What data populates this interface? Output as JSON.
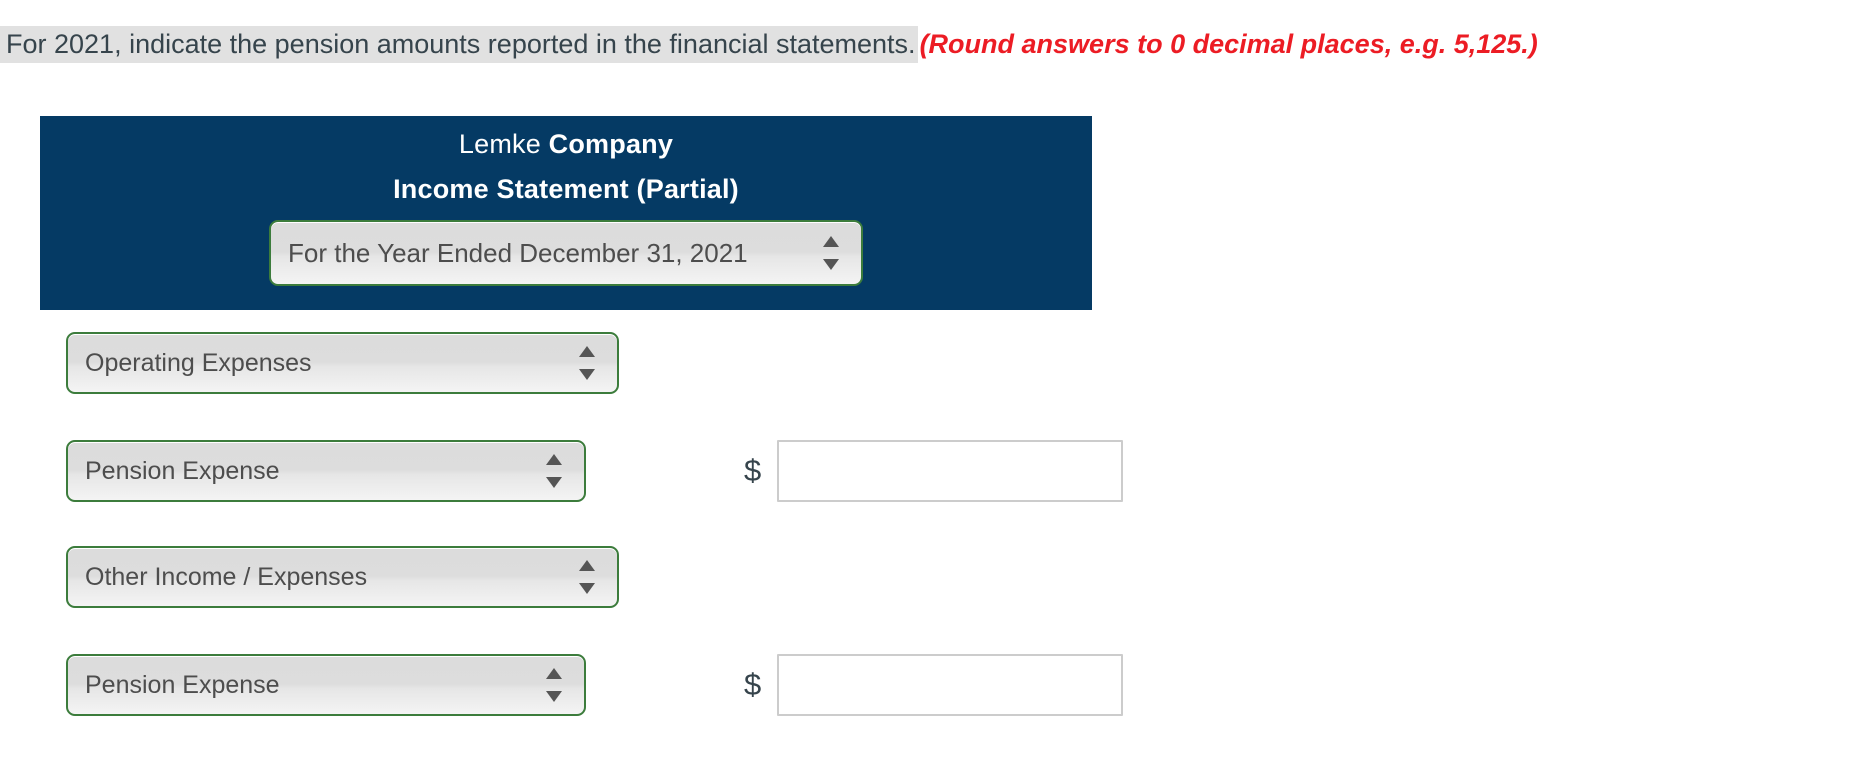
{
  "prompt": {
    "text": "For 2021, indicate the pension amounts reported in the financial statements.",
    "note": "(Round answers to 0 decimal places, e.g. 5,125.)",
    "highlight_color": "#e1e1e1",
    "note_color": "#ec1c24"
  },
  "statement": {
    "company_prefix": "Lemke ",
    "company_name": "Company",
    "title": "Income Statement (Partial)",
    "header_color": "#053a64",
    "period_select": {
      "value": "For the Year Ended December 31, 2021",
      "icon": "spinner-arrows-icon"
    }
  },
  "rows": [
    {
      "select": {
        "value": "Operating Expenses",
        "icon": "spinner-arrows-icon"
      },
      "has_amount": false,
      "currency": "",
      "amount_value": "",
      "amount_placeholder": ""
    },
    {
      "select": {
        "value": "Pension Expense",
        "icon": "spinner-arrows-icon"
      },
      "has_amount": true,
      "currency": "$",
      "amount_value": "",
      "amount_placeholder": ""
    },
    {
      "select": {
        "value": "Other Income / Expenses",
        "icon": "spinner-arrows-icon"
      },
      "has_amount": false,
      "currency": "",
      "amount_value": "",
      "amount_placeholder": ""
    },
    {
      "select": {
        "value": "Pension Expense",
        "icon": "spinner-arrows-icon"
      },
      "has_amount": true,
      "currency": "$",
      "amount_value": "",
      "amount_placeholder": ""
    }
  ],
  "colors": {
    "select_border": "#3c7c3c",
    "select_text": "#4d4d4d",
    "input_border": "#cccccc",
    "body_text": "#36444c"
  }
}
